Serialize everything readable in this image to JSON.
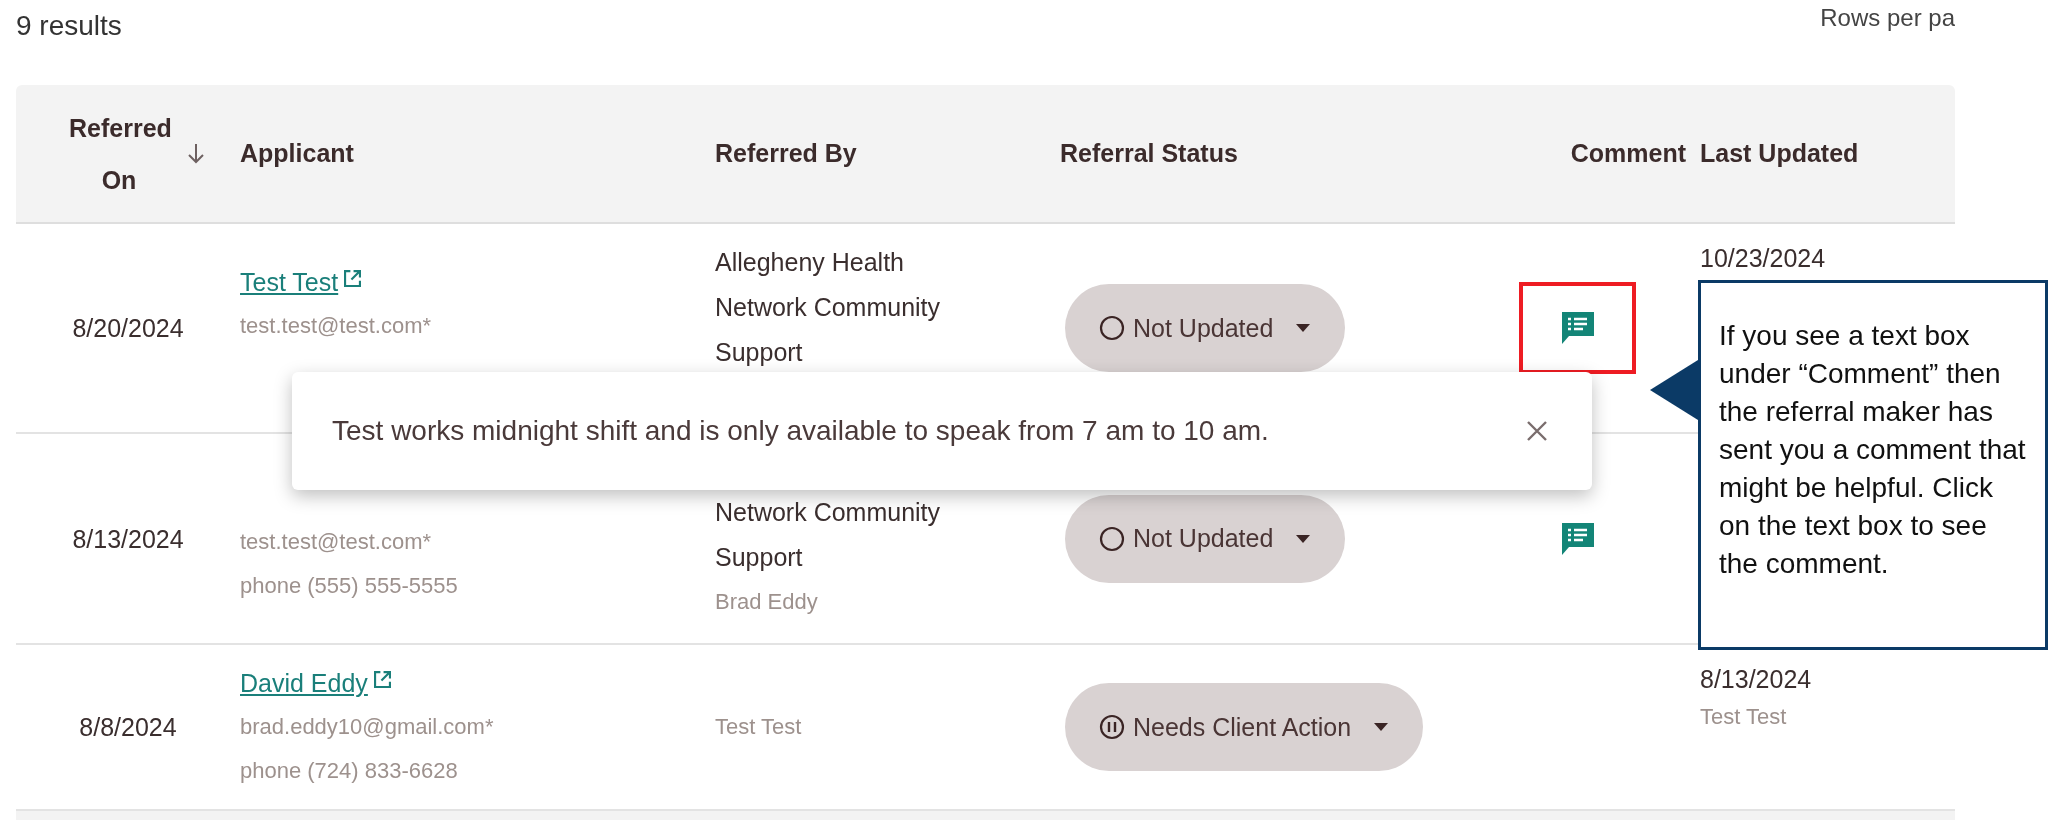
{
  "results_count": "9 results",
  "rows_per_page_label": "Rows per pa",
  "table": {
    "columns": [
      {
        "label": "Referred On",
        "sorted": true
      },
      {
        "label": "Applicant",
        "sorted": false
      },
      {
        "label": "Referred By",
        "sorted": false
      },
      {
        "label": "Referral Status",
        "sorted": false
      },
      {
        "label": "Comment",
        "sorted": false
      },
      {
        "label": "Last Updated",
        "sorted": false
      }
    ],
    "rows": [
      {
        "referred_on": "8/20/2024",
        "applicant": {
          "name": "Test Test",
          "email": "test.test@test.com*"
        },
        "referred_by": {
          "organization": "Allegheny Health Network Community Support"
        },
        "status": {
          "label": "Not Updated",
          "kind": "not_updated"
        },
        "comment": {
          "present": true,
          "highlighted": true
        },
        "last_updated": {
          "date": "10/23/2024"
        }
      },
      {
        "referred_on": "8/13/2024",
        "applicant": {
          "email": "test.test@test.com*",
          "phone": "phone (555) 555-5555"
        },
        "referred_by": {
          "organization": "Network Community Support",
          "person": "Brad Eddy"
        },
        "status": {
          "label": "Not Updated",
          "kind": "not_updated"
        },
        "comment": {
          "present": true,
          "highlighted": false
        }
      },
      {
        "referred_on": "8/8/2024",
        "applicant": {
          "name": "David Eddy",
          "email": "brad.eddy10@gmail.com*",
          "phone": "phone (724) 833-6628"
        },
        "referred_by": {
          "person": "Test Test"
        },
        "status": {
          "label": "Needs Client Action",
          "kind": "needs_client_action"
        },
        "comment": {
          "present": false,
          "highlighted": false
        },
        "last_updated": {
          "date": "8/13/2024",
          "by": "Test Test"
        }
      }
    ]
  },
  "comment_popup": {
    "text": "Test works midnight shift and is only available to speak from 7 am to 10 am."
  },
  "annotation": {
    "text": "If you see a text box under “Comment” then the referral maker has sent you a comment that might be helpful. Click on the text box to see the comment."
  }
}
